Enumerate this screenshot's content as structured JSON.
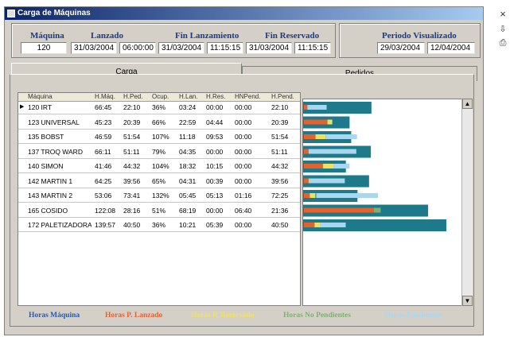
{
  "window": {
    "title": "Carga de Máquinas",
    "close": "×"
  },
  "header": {
    "maquina_label": "Máquina",
    "lanzado_label": "Lanzado",
    "fin_lanz_label": "Fin Lanzamiento",
    "fin_res_label": "Fin Reservado",
    "periodo_label": "Periodo Visualizado",
    "maquina": "120",
    "lanzado_date": "31/03/2004",
    "lanzado_time": "06:00:00",
    "fin_lanz_date": "31/03/2004",
    "fin_lanz_time": "11:15:15",
    "fin_res_date": "31/03/2004",
    "fin_res_time": "11:15:15",
    "periodo_from": "29/03/2004",
    "periodo_to": "12/04/2004"
  },
  "tabs": [
    {
      "label": "Carga"
    },
    {
      "label": "Pedidos"
    }
  ],
  "grid": {
    "columns": [
      "Máquina",
      "H.Máq.",
      "H.Ped.",
      "Ocup.",
      "H.Lan.",
      "H.Res.",
      "HNPend.",
      "H.Pend."
    ],
    "rows": [
      [
        "120 IRT",
        "66:45",
        "22:10",
        "36%",
        "03:24",
        "00:00",
        "00:00",
        "22:10"
      ],
      [
        "123 UNIVERSAL",
        "45:23",
        "20:39",
        "66%",
        "22:59",
        "04:44",
        "00:00",
        "20:39"
      ],
      [
        "135 BOBST",
        "46:59",
        "51:54",
        "107%",
        "11:18",
        "09:53",
        "00:00",
        "51:54"
      ],
      [
        "137 TROQ WARD",
        "66:11",
        "51:11",
        "79%",
        "04:35",
        "00:00",
        "00:00",
        "51:11"
      ],
      [
        "140 SIMON",
        "41:46",
        "44:32",
        "104%",
        "18:32",
        "10:15",
        "00:00",
        "44:32"
      ],
      [
        "142 MARTIN 1",
        "64:25",
        "39:56",
        "65%",
        "04:31",
        "00:39",
        "00:00",
        "39:56"
      ],
      [
        "143 MARTIN 2",
        "53:06",
        "73:41",
        "132%",
        "05:45",
        "05:13",
        "01:16",
        "72:25"
      ],
      [
        "165 COSIDO",
        "122:08",
        "28:16",
        "51%",
        "68:19",
        "00:00",
        "06:40",
        "21:36"
      ],
      [
        "172 PALETIZADORA",
        "139:57",
        "40:50",
        "36%",
        "10:21",
        "05:39",
        "00:00",
        "40:50"
      ]
    ]
  },
  "legend": [
    {
      "label": "Horas Máquina",
      "color": "#2a5aa8"
    },
    {
      "label": "Horas P. Lanzado",
      "color": "#e8602a"
    },
    {
      "label": "Horas P. Reservado",
      "color": "#f0e060"
    },
    {
      "label": "Horas No Pendientes",
      "color": "#7fb070"
    },
    {
      "label": "Horas Pendientes",
      "color": "#a8d8f0"
    }
  ],
  "colors": {
    "machine": "#1e7a8a",
    "lanzado": "#e8602a",
    "reservado": "#f0e060",
    "nopend": "#7fb070",
    "pend": "#a8d8f0"
  },
  "chart_data": {
    "type": "bar",
    "categories": [
      "120 IRT",
      "123 UNIVERSAL",
      "135 BOBST",
      "137 TROQ WARD",
      "140 SIMON",
      "142 MARTIN 1",
      "143 MARTIN 2",
      "165 COSIDO",
      "172 PALETIZADORA"
    ],
    "series": [
      {
        "name": "Horas Máquina",
        "values": [
          66.75,
          45.38,
          46.98,
          66.18,
          41.77,
          64.42,
          53.1,
          122.13,
          139.95
        ]
      },
      {
        "name": "Horas P. Lanzado",
        "values": [
          3.4,
          22.98,
          11.3,
          4.58,
          18.53,
          4.52,
          5.75,
          68.32,
          10.35
        ]
      },
      {
        "name": "Horas P. Reservado",
        "values": [
          0,
          4.73,
          9.88,
          0,
          10.25,
          0.65,
          5.22,
          0,
          5.65
        ]
      },
      {
        "name": "Horas No Pendientes",
        "values": [
          0,
          0,
          0,
          0,
          0,
          0,
          1.27,
          6.67,
          0
        ]
      },
      {
        "name": "Horas Pendientes",
        "values": [
          22.17,
          20.65,
          51.9,
          51.18,
          44.53,
          39.93,
          72.42,
          21.6,
          40.83
        ]
      }
    ]
  }
}
